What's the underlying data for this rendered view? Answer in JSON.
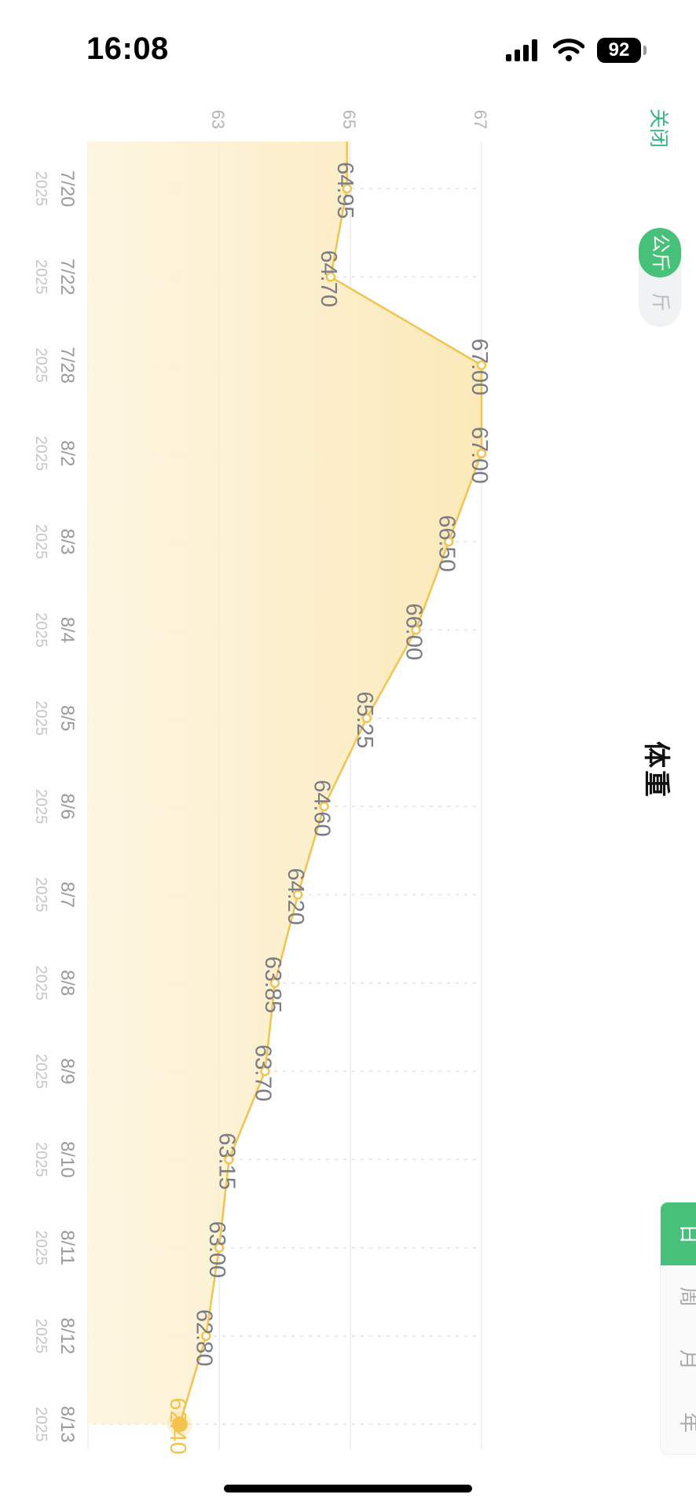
{
  "status_bar": {
    "time": "16:08",
    "battery": "92"
  },
  "header": {
    "close_label": "关闭",
    "title": "体重"
  },
  "unit_toggle": {
    "options": [
      "公斤",
      "斤"
    ],
    "selected": "公斤"
  },
  "period_tabs": {
    "options": [
      "日",
      "周",
      "月",
      "年"
    ],
    "selected": "日"
  },
  "colors": {
    "line": "#f2c44e",
    "area": "#fbe9b8",
    "accent": "#47c07a",
    "close": "#36b37e"
  },
  "chart_data": {
    "type": "area",
    "orientation": "rotated-90-clockwise",
    "categories": [
      "7/20",
      "7/22",
      "7/28",
      "8/2",
      "8/3",
      "8/4",
      "8/5",
      "8/6",
      "8/7",
      "8/8",
      "8/9",
      "8/10",
      "8/11",
      "8/12",
      "8/13"
    ],
    "years": [
      "2025",
      "2025",
      "2025",
      "2025",
      "2025",
      "2025",
      "2025",
      "2025",
      "2025",
      "2025",
      "2025",
      "2025",
      "2025",
      "2025",
      "2025"
    ],
    "values": [
      64.95,
      64.7,
      67.0,
      67.0,
      66.5,
      66.0,
      65.25,
      64.6,
      64.2,
      63.85,
      63.7,
      63.15,
      63.0,
      62.8,
      62.4
    ],
    "value_labels": [
      "64.95",
      "64.70",
      "67.00",
      "67.00",
      "66.50",
      "66.00",
      "65.25",
      "64.60",
      "64.20",
      "63.85",
      "63.70",
      "63.15",
      "63.00",
      "62.80",
      "62.40"
    ],
    "yticks": [
      "63",
      "65",
      "67"
    ],
    "highlight_index": 14,
    "grid": true
  }
}
